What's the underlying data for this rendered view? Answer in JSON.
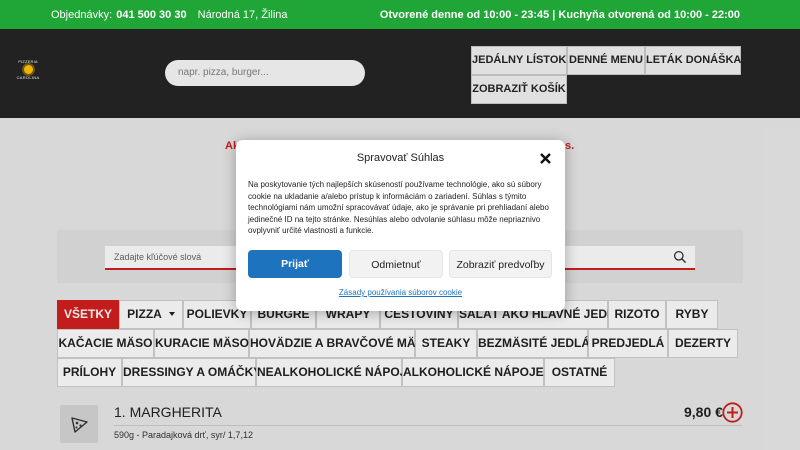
{
  "topbar": {
    "orders_label": "Objednávky:",
    "phone": "041 500 30 30",
    "address": "Národná 17, Žilina",
    "hours": "Otvorené denne od 10:00 - 23:45 | Kuchyňa otvorená od 10:00 - 22:00"
  },
  "logo": {
    "line1": "PIZZERIA",
    "line2": "CAROLINA"
  },
  "header": {
    "search_placeholder": "napr. pizza, burger...",
    "nav": [
      "JEDÁLNY LÍSTOK",
      "DENNÉ MENU",
      "LETÁK DONÁŠKA",
      "ZOBRAZIŤ KOŠÍK"
    ]
  },
  "promo": {
    "left": "Ak",
    "right": "s."
  },
  "menu_search": {
    "placeholder": "Zadajte kľúčové slová"
  },
  "categories": [
    "VŠETKY",
    "PIZZA",
    "POLIEVKY",
    "BURGRE",
    "WRAPY",
    "CESTOVINY",
    "ŠALÁT AKO HLAVNÉ JEDLO",
    "RIZOTO",
    "RYBY",
    "KAČACIE MÄSO",
    "KURACIE MÄSO",
    "HOVÄDZIE A BRAVČOVÉ MÄSO",
    "STEAKY",
    "BEZMÄSITÉ JEDLÁ",
    "PREDJEDLÁ",
    "DEZERTY",
    "PRÍLOHY",
    "DRESSINGY A OMÁČKY",
    "NEALKOHOLICKÉ NÁPOJE",
    "ALKOHOLICKÉ NÁPOJE",
    "OSTATNÉ"
  ],
  "product": {
    "name": "1. MARGHERITA",
    "description": "590g - Paradajková drť, syr/ 1,7,12",
    "price": "9,80 €"
  },
  "consent": {
    "title": "Spravovať Súhlas",
    "text": "Na poskytovanie tých najlepších skúseností používame technológie, ako sú súbory cookie na ukladanie a/alebo prístup k informáciám o zariadení. Súhlas s týmito technológiami nám umožní spracovávať údaje, ako je správanie pri prehliadaní alebo jedinečné ID na tejto stránke. Nesúhlas alebo odvolanie súhlasu môže nepriaznivo ovplyvniť určité vlastnosti a funkcie.",
    "accept": "Prijať",
    "deny": "Odmietnuť",
    "preferences": "Zobraziť predvoľby",
    "policy_link": "Zásady používania súborov cookie"
  },
  "colors": {
    "brand_green": "#1fa637",
    "header_dark": "#222222",
    "accent_red": "#d31f1f",
    "button_blue": "#1e73be"
  }
}
